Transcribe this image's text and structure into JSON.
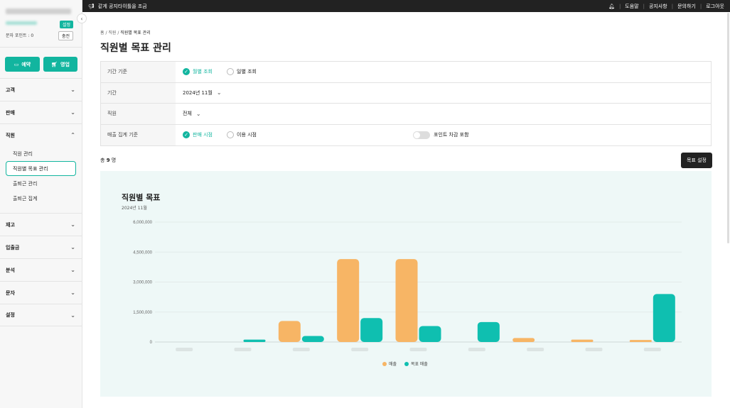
{
  "topbar": {
    "notice": "같게 공지타이틀을 조금",
    "links": [
      "도움말",
      "공지사항",
      "문의하기",
      "로그아웃"
    ]
  },
  "sidebar": {
    "badge": "설정",
    "points_label": "문자 포인트 : 0",
    "charge_label": "충전",
    "reserve_label": "예약",
    "sales_label": "영업",
    "groups": [
      {
        "label": "고객"
      },
      {
        "label": "판매"
      },
      {
        "label": "직원",
        "open": true,
        "items": [
          "직원 관리",
          "직원별 목표 관리",
          "출퇴근 관리",
          "출퇴근 집계"
        ]
      },
      {
        "label": "재고"
      },
      {
        "label": "입출금"
      },
      {
        "label": "분석"
      },
      {
        "label": "문자"
      },
      {
        "label": "설정"
      }
    ]
  },
  "breadcrumb": [
    "홈",
    "직원",
    "직원별 목표 관리"
  ],
  "page_title": "직원별 목표 관리",
  "filters": {
    "period_basis": {
      "label": "기간 기준",
      "options": [
        "월별 조회",
        "일별 조회"
      ],
      "selected": "월별 조회"
    },
    "period": {
      "label": "기간",
      "value": "2024년 11월"
    },
    "staff": {
      "label": "직원",
      "value": "전체"
    },
    "sales_basis": {
      "label": "매출 집계 기준",
      "options": [
        "판매 시점",
        "이용 시점"
      ],
      "selected": "판매 시점",
      "toggle_label": "포인트 차감 포함"
    }
  },
  "count": {
    "prefix": "총",
    "value": "9",
    "suffix": "명"
  },
  "goal_button": "목표 설정",
  "colors": {
    "accent": "#12b59f",
    "sales": "#f7b565",
    "target": "#0fbfb0"
  },
  "chart_data": {
    "type": "bar",
    "title": "직원별 목표",
    "subtitle": "2024년 11월",
    "categories": [
      "",
      "",
      "",
      "",
      "",
      "",
      "",
      "",
      ""
    ],
    "ylim": [
      0,
      6000000
    ],
    "yticks": [
      "0",
      "1,500,000",
      "3,000,000",
      "4,500,000",
      "6,000,000"
    ],
    "series": [
      {
        "name": "매출",
        "color": "#f7b565",
        "values": [
          0,
          0,
          1050000,
          4150000,
          4150000,
          0,
          200000,
          120000,
          100000
        ]
      },
      {
        "name": "목표 매출",
        "color": "#0fbfb0",
        "values": [
          0,
          120000,
          300000,
          1200000,
          800000,
          1000000,
          0,
          0,
          2400000
        ]
      }
    ],
    "legend": "bottom",
    "grid": true
  }
}
